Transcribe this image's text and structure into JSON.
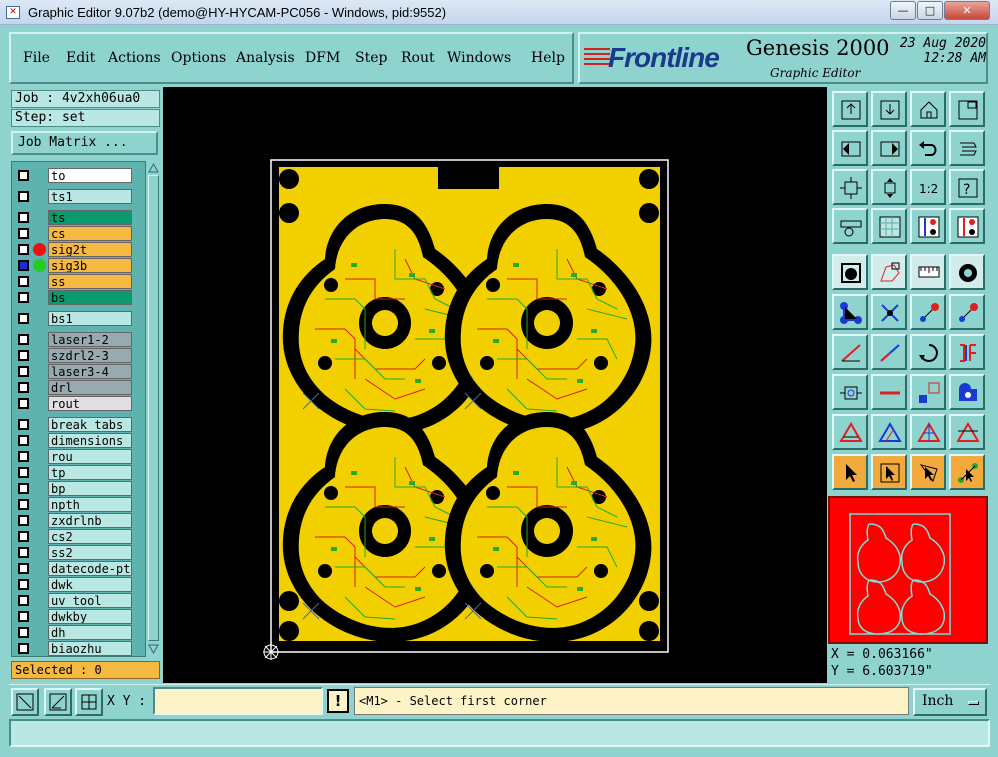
{
  "window": {
    "title": "Graphic Editor 9.07b2 (demo@HY-HYCAM-PC056 - Windows, pid:9552)",
    "app_icon": "x-icon",
    "minimize": "—",
    "maximize": "□",
    "close": "✕"
  },
  "menu": {
    "items": [
      "File",
      "Edit",
      "Actions",
      "Options",
      "Analysis",
      "DFM",
      "Step",
      "Rout",
      "Windows",
      "Help"
    ]
  },
  "brand": {
    "logo": "Frontline",
    "product": "Genesis 2000",
    "subtitle": "Graphic Editor",
    "date": "23 Aug 2020",
    "time": "12:28 AM"
  },
  "job": {
    "job_label": "Job : 4v2xh06ua0",
    "step_label": "Step: set",
    "job_matrix": "Job Matrix ..."
  },
  "layers": [
    {
      "name": "to",
      "color": "#ffffff",
      "group": 1,
      "dot": ""
    },
    {
      "name": "ts1",
      "color": "#b8e7e4",
      "group": 2,
      "dot": ""
    },
    {
      "name": "ts",
      "color": "#0a9a6e",
      "group": 3,
      "dot": ""
    },
    {
      "name": "cs",
      "color": "#f5b840",
      "group": 3,
      "dot": ""
    },
    {
      "name": "sig2t",
      "color": "#f5b840",
      "group": 3,
      "dot": "#ee1111"
    },
    {
      "name": "sig3b",
      "color": "#f5b840",
      "group": 3,
      "dot": "#22cc22",
      "checked": true
    },
    {
      "name": "ss",
      "color": "#f5b840",
      "group": 3,
      "dot": ""
    },
    {
      "name": "bs",
      "color": "#0a9a6e",
      "group": 3,
      "dot": ""
    },
    {
      "name": "bs1",
      "color": "#b8e7e4",
      "group": 4,
      "dot": ""
    },
    {
      "name": "laser1-2",
      "color": "#96aab0",
      "group": 5,
      "dot": ""
    },
    {
      "name": "szdrl2-3",
      "color": "#96aab0",
      "group": 5,
      "dot": ""
    },
    {
      "name": "laser3-4",
      "color": "#96aab0",
      "group": 5,
      "dot": ""
    },
    {
      "name": "drl",
      "color": "#96aab0",
      "group": 5,
      "dot": ""
    },
    {
      "name": "rout",
      "color": "#e0e0e0",
      "group": 5,
      "dot": ""
    },
    {
      "name": "break_tabs",
      "color": "#b8e7e4",
      "group": 6,
      "dot": ""
    },
    {
      "name": "dimensions",
      "color": "#b8e7e4",
      "group": 6,
      "dot": ""
    },
    {
      "name": "rou",
      "color": "#b8e7e4",
      "group": 6,
      "dot": ""
    },
    {
      "name": "tp",
      "color": "#b8e7e4",
      "group": 6,
      "dot": ""
    },
    {
      "name": "bp",
      "color": "#b8e7e4",
      "group": 6,
      "dot": ""
    },
    {
      "name": "npth",
      "color": "#b8e7e4",
      "group": 6,
      "dot": ""
    },
    {
      "name": "zxdrlnb",
      "color": "#b8e7e4",
      "group": 6,
      "dot": ""
    },
    {
      "name": "cs2",
      "color": "#b8e7e4",
      "group": 6,
      "dot": ""
    },
    {
      "name": "ss2",
      "color": "#b8e7e4",
      "group": 6,
      "dot": ""
    },
    {
      "name": "datecode-pt",
      "color": "#b8e7e4",
      "group": 6,
      "dot": ""
    },
    {
      "name": "dwk",
      "color": "#b8e7e4",
      "group": 6,
      "dot": ""
    },
    {
      "name": "uv_tool",
      "color": "#b8e7e4",
      "group": 6,
      "dot": ""
    },
    {
      "name": "dwkby",
      "color": "#b8e7e4",
      "group": 6,
      "dot": ""
    },
    {
      "name": "dh",
      "color": "#b8e7e4",
      "group": 6,
      "dot": ""
    },
    {
      "name": "biaozhu",
      "color": "#b8e7e4",
      "group": 6,
      "dot": ""
    }
  ],
  "selected": "Selected : 0",
  "coords": {
    "x": "X = 0.063166\"",
    "y": "Y = 6.603719\""
  },
  "bottom": {
    "xy_label": "X Y :",
    "xy_value": "",
    "prompt": "<M1> - Select first corner",
    "units": "Inch",
    "status": ""
  },
  "toolbox": {
    "group1": [
      "home-left-icon",
      "home-right-icon",
      "house-icon",
      "window-icon",
      "pan-left-icon",
      "pan-right-icon",
      "undo-view-icon",
      "redraw-icon",
      "fit-icon",
      "zoom-center-icon",
      "one-to-two-icon",
      "question-icon",
      "ruler-icon",
      "grid-icon",
      "snap-red-icon",
      "snap-blue-icon"
    ],
    "group2": [
      "square-select-icon",
      "polygon-icon",
      "measure-icon",
      "circle-icon",
      "blue-connect-icon",
      "cross-icon",
      "vector-red-icon",
      "vector-blue-icon",
      "line-red-icon",
      "line-blue-icon",
      "rotate-icon",
      "bracket-icon",
      "pad-icon",
      "minus-icon",
      "small-box-icon",
      "blob-icon",
      "triangle-red-icon",
      "triangle-cross-icon",
      "triangle-bar-icon",
      "triangle-split-icon",
      "arrow-icon",
      "arrow-box-icon",
      "arrow-tilt-icon",
      "connect-arrow-icon"
    ]
  },
  "colors": {
    "bg": "#8fd3cf",
    "board": "#f2d000",
    "copper_red": "#d42020",
    "trace_green": "#27a92b"
  }
}
